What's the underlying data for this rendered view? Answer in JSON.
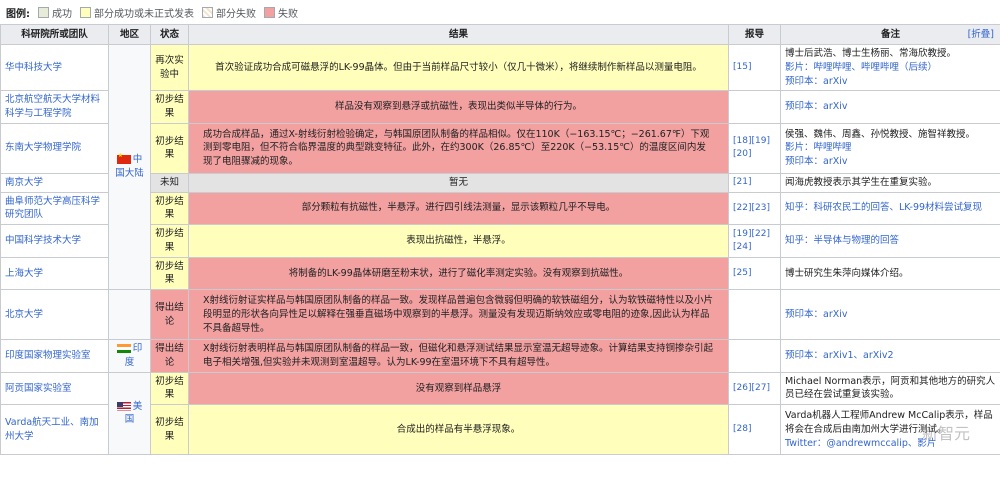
{
  "legend": {
    "title": "图例:",
    "items": [
      {
        "label": "成功",
        "color": "#e6ecd8"
      },
      {
        "label": "部分成功或未正式发表",
        "color": "#ffffbb"
      },
      {
        "label": "部分失败",
        "color": "#f3e3c8"
      },
      {
        "label": "失败",
        "color": "#f2a0a0"
      }
    ]
  },
  "headers": {
    "org": "科研院所或团队",
    "region": "地区",
    "status": "状态",
    "result": "结果",
    "ref": "报导",
    "notes": "备注",
    "collapse": "[折叠]"
  },
  "regions": {
    "china": "中国大陆",
    "india": "印度",
    "usa": "美国"
  },
  "rows": [
    {
      "org": "华中科技大学",
      "status": "再次实验中",
      "result": "首次验证成功合成可磁悬浮的LK-99晶体。但由于当前样品尺寸较小（仅几十微米），将继续制作新样品以测量电阻。",
      "ref": "[15]",
      "notes": [
        "博士后武浩、博士生杨丽、常海欣教授。",
        "影片：哔哩哔哩、哔哩哔哩（后续）",
        "预印本：arXiv"
      ]
    },
    {
      "org": "北京航空航天大学材料科学与工程学院",
      "status": "初步结果",
      "result": "样品没有观察到悬浮或抗磁性，表现出类似半导体的行为。",
      "ref": "",
      "notes": [
        "预印本：arXiv"
      ]
    },
    {
      "org": "东南大学物理学院",
      "status": "初步结果",
      "result": "成功合成样品，通过X-射线衍射检验确定，与韩国原团队制备的样品相似。仅在110K（−163.15℃；−261.67℉）下观测到零电阻，但不符合临界温度的典型跳变特征。此外，在约300K（26.85℃）至220K（−53.15℃）的温度区间内发现了电阻骤减的现象。",
      "ref": "[18][19][20]",
      "notes": [
        "侯强、魏伟、周鑫、孙悦教授、施智祥教授。",
        "影片：哔哩哔哩",
        "预印本：arXiv"
      ]
    },
    {
      "org": "南京大学",
      "status": "未知",
      "result": "暂无",
      "ref": "[21]",
      "notes": [
        "闻海虎教授表示其学生在重复实验。"
      ]
    },
    {
      "org": "曲阜师范大学高压科学研究团队",
      "status": "初步结果",
      "result": "部分颗粒有抗磁性，半悬浮。进行四引线法测量，显示该颗粒几乎不导电。",
      "ref": "[22][23]",
      "notes": [
        "知乎：科研农民工的回答、LK-99材料尝试复现"
      ]
    },
    {
      "org": "中国科学技术大学",
      "status": "初步结果",
      "result": "表现出抗磁性，半悬浮。",
      "ref": "[19][22][24]",
      "notes": [
        "知乎：半导体与物理的回答"
      ]
    },
    {
      "org": "上海大学",
      "status": "初步结果",
      "result": "将制备的LK-99晶体研磨至粉末状，进行了磁化率测定实验。没有观察到抗磁性。",
      "ref": "[25]",
      "notes": [
        "博士研究生朱萍向媒体介绍。"
      ]
    },
    {
      "org": "北京大学",
      "status": "得出结论",
      "result": "X射线衍射证实样品与韩国原团队制备的样品一致。发现样品普遍包含微弱但明确的软铁磁组分，认为软铁磁特性以及小片段明显的形状各向异性足以解释在强垂直磁场中观察到的半悬浮。测量没有发现迈斯纳效应或零电阻的迹象,因此认为样品不具备超导性。",
      "ref": "",
      "notes": [
        "预印本：arXiv"
      ]
    },
    {
      "org": "印度国家物理实验室",
      "status": "得出结论",
      "result": "X射线衍射表明样品与韩国原团队制备的样品一致，但磁化和悬浮测试结果显示室温无超导迹象。计算结果支持铜掺杂引起电子相关增强,但实验并未观测到室温超导。认为LK-99在室温环境下不具有超导性。",
      "ref": "",
      "notes": [
        "预印本：arXiv1、arXiv2"
      ]
    },
    {
      "org": "阿贡国家实验室",
      "status": "初步结果",
      "result": "没有观察到样品悬浮",
      "ref": "[26][27]",
      "notes": [
        "Michael Norman表示，阿贡和其他地方的研究人员已经在尝试重复该实验。"
      ]
    },
    {
      "org": "Varda航天工业、南加州大学",
      "status": "初步结果",
      "result": "合成出的样品有半悬浮现象。",
      "ref": "[28]",
      "notes": [
        "Varda机器人工程师Andrew McCalip表示，样品将会在合成后由南加州大学进行测试。",
        "Twitter：@andrewmccalip、影片"
      ]
    }
  ],
  "watermark": "新智元"
}
